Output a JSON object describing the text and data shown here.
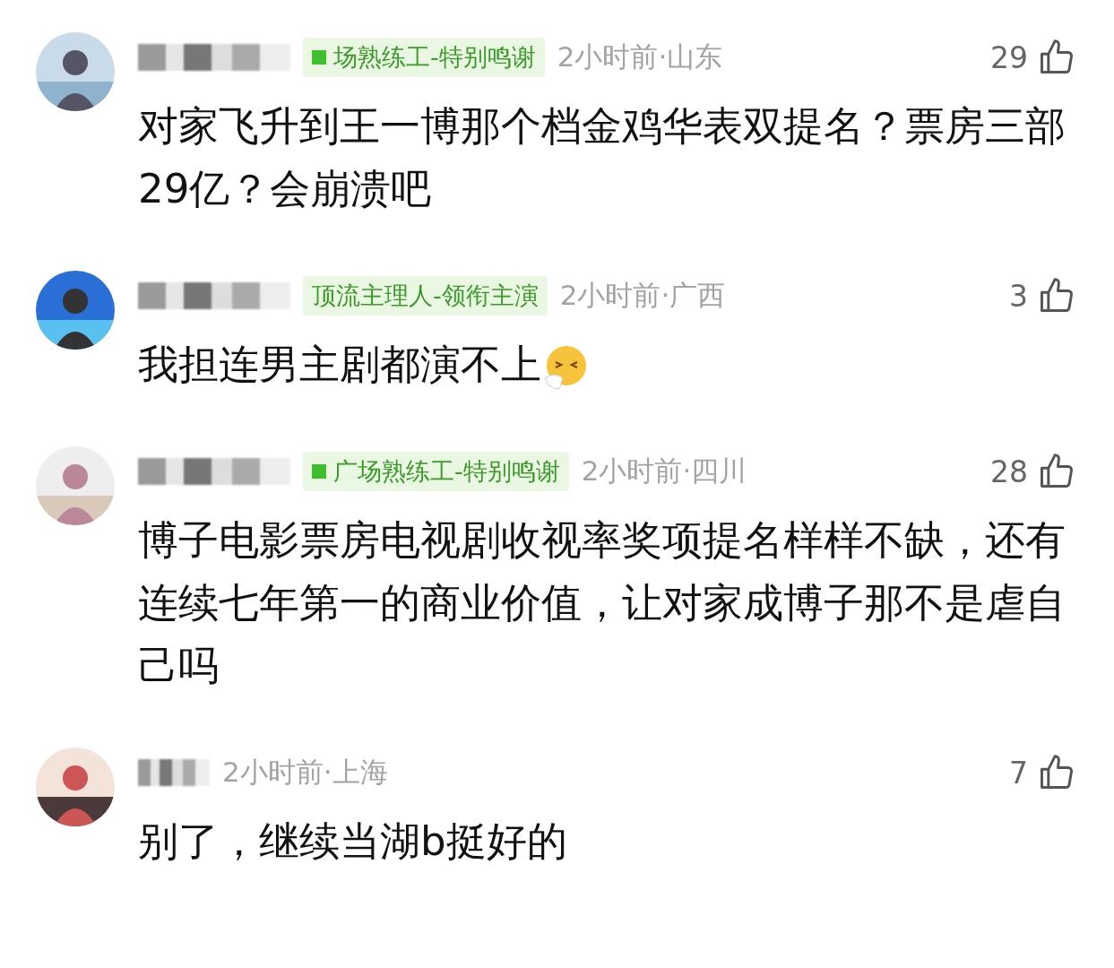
{
  "comments": [
    {
      "badge": "场熟练工-特别鸣谢",
      "badge_square": true,
      "meta": "2小时前·山东",
      "likes": "29",
      "text": "对家飞升到王一博那个档金鸡华表双提名？票房三部29亿？会崩溃吧",
      "trailing_emoji": false
    },
    {
      "badge": "顶流主理人-领衔主演",
      "badge_square": false,
      "meta": "2小时前·广西",
      "likes": "3",
      "text": "我担连男主剧都演不上",
      "trailing_emoji": true
    },
    {
      "badge": "广场熟练工-特别鸣谢",
      "badge_square": true,
      "meta": "2小时前·四川",
      "likes": "28",
      "text": "博子电影票房电视剧收视率奖项提名样样不缺，还有连续七年第一的商业价值，让对家成博子那不是虐自己吗",
      "trailing_emoji": false
    },
    {
      "meta": "2小时前·上海",
      "likes": "7",
      "text": "别了，继续当湖b挺好的",
      "trailing_emoji": false
    }
  ]
}
